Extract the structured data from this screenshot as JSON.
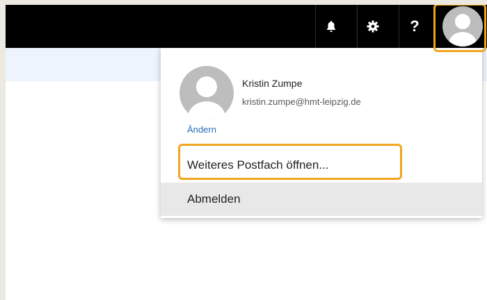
{
  "header": {
    "bell_icon": "bell-icon",
    "settings_icon": "gear-icon",
    "help_label": "?",
    "avatar_icon": "user-avatar-icon"
  },
  "profile": {
    "name": "Kristin Zumpe",
    "email": "kristin.zumpe@hmt-leipzig.de",
    "change_label": "Ändern"
  },
  "menu": {
    "open_mailbox_label": "Weiteres Postfach öffnen...",
    "logout_label": "Abmelden"
  },
  "colors": {
    "topbar": "#000000",
    "highlight": "#f0a51e",
    "link": "#2a6ebb",
    "hover_row": "#e8e8e8"
  }
}
